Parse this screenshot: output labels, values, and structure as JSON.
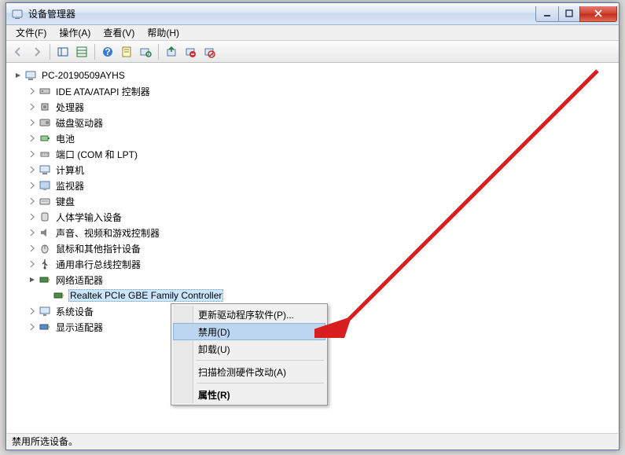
{
  "window": {
    "title": "设备管理器"
  },
  "menu": {
    "file": "文件(F)",
    "action": "操作(A)",
    "view": "查看(V)",
    "help": "帮助(H)"
  },
  "tree": {
    "root": "PC-20190509AYHS",
    "items": [
      "IDE ATA/ATAPI 控制器",
      "处理器",
      "磁盘驱动器",
      "电池",
      "端口 (COM 和 LPT)",
      "计算机",
      "监视器",
      "键盘",
      "人体学输入设备",
      "声音、视频和游戏控制器",
      "鼠标和其他指针设备",
      "通用串行总线控制器",
      "网络适配器",
      "系统设备",
      "显示适配器"
    ],
    "net_child": "Realtek PCIe GBE Family Controller"
  },
  "context": {
    "update": "更新驱动程序软件(P)...",
    "disable": "禁用(D)",
    "uninstall": "卸载(U)",
    "scan": "扫描检测硬件改动(A)",
    "properties": "属性(R)"
  },
  "status": "禁用所选设备。"
}
